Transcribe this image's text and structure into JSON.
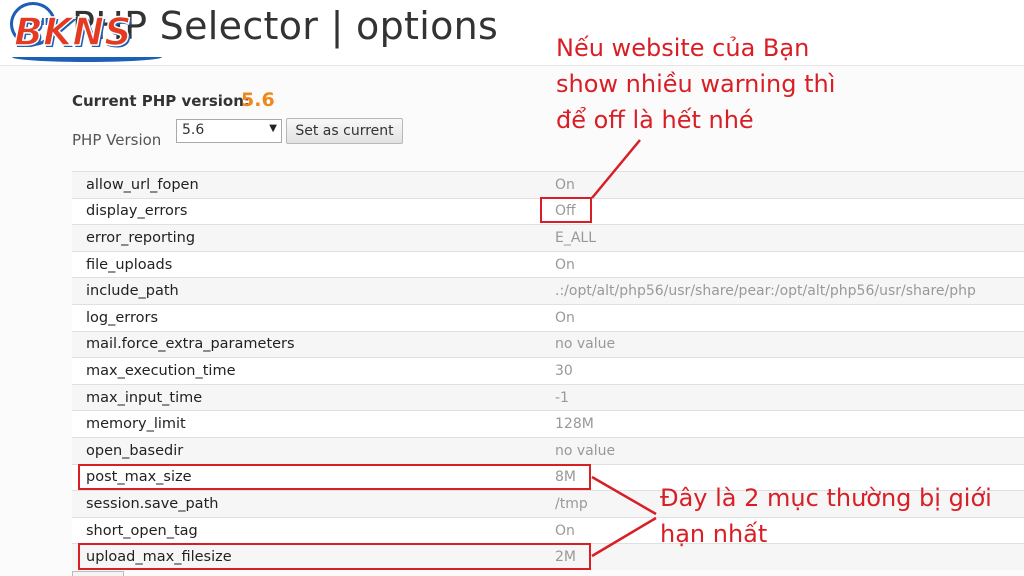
{
  "header": {
    "title": "PHP Selector | options",
    "logo": {
      "text": "BKNS",
      "badge": "PHP"
    }
  },
  "current_version": {
    "label": "Current PHP version:",
    "value": "5.6"
  },
  "version_selector": {
    "label": "PHP Version",
    "selected": "5.6",
    "button_label": "Set as current"
  },
  "options": [
    {
      "name": "allow_url_fopen",
      "value": "On"
    },
    {
      "name": "display_errors",
      "value": "Off"
    },
    {
      "name": "error_reporting",
      "value": "E_ALL"
    },
    {
      "name": "file_uploads",
      "value": "On"
    },
    {
      "name": "include_path",
      "value": ".:/opt/alt/php56/usr/share/pear:/opt/alt/php56/usr/share/php"
    },
    {
      "name": "log_errors",
      "value": "On"
    },
    {
      "name": "mail.force_extra_parameters",
      "value": "no value"
    },
    {
      "name": "max_execution_time",
      "value": "30"
    },
    {
      "name": "max_input_time",
      "value": "-1"
    },
    {
      "name": "memory_limit",
      "value": "128M"
    },
    {
      "name": "open_basedir",
      "value": "no value"
    },
    {
      "name": "post_max_size",
      "value": "8M"
    },
    {
      "name": "session.save_path",
      "value": "/tmp"
    },
    {
      "name": "short_open_tag",
      "value": "On"
    },
    {
      "name": "upload_max_filesize",
      "value": "2M"
    }
  ],
  "annotations": {
    "note_top": [
      "Nếu website của Bạn",
      "show nhiều warning thì",
      "để off là hết nhé"
    ],
    "note_bottom": [
      "Đây là 2 mục thường bị giới",
      "hạn nhất"
    ]
  },
  "colors": {
    "annotation_red": "#d81f26",
    "version_orange": "#f0871b",
    "logo_red": "#e43a22",
    "logo_blue": "#1c5fb5"
  }
}
